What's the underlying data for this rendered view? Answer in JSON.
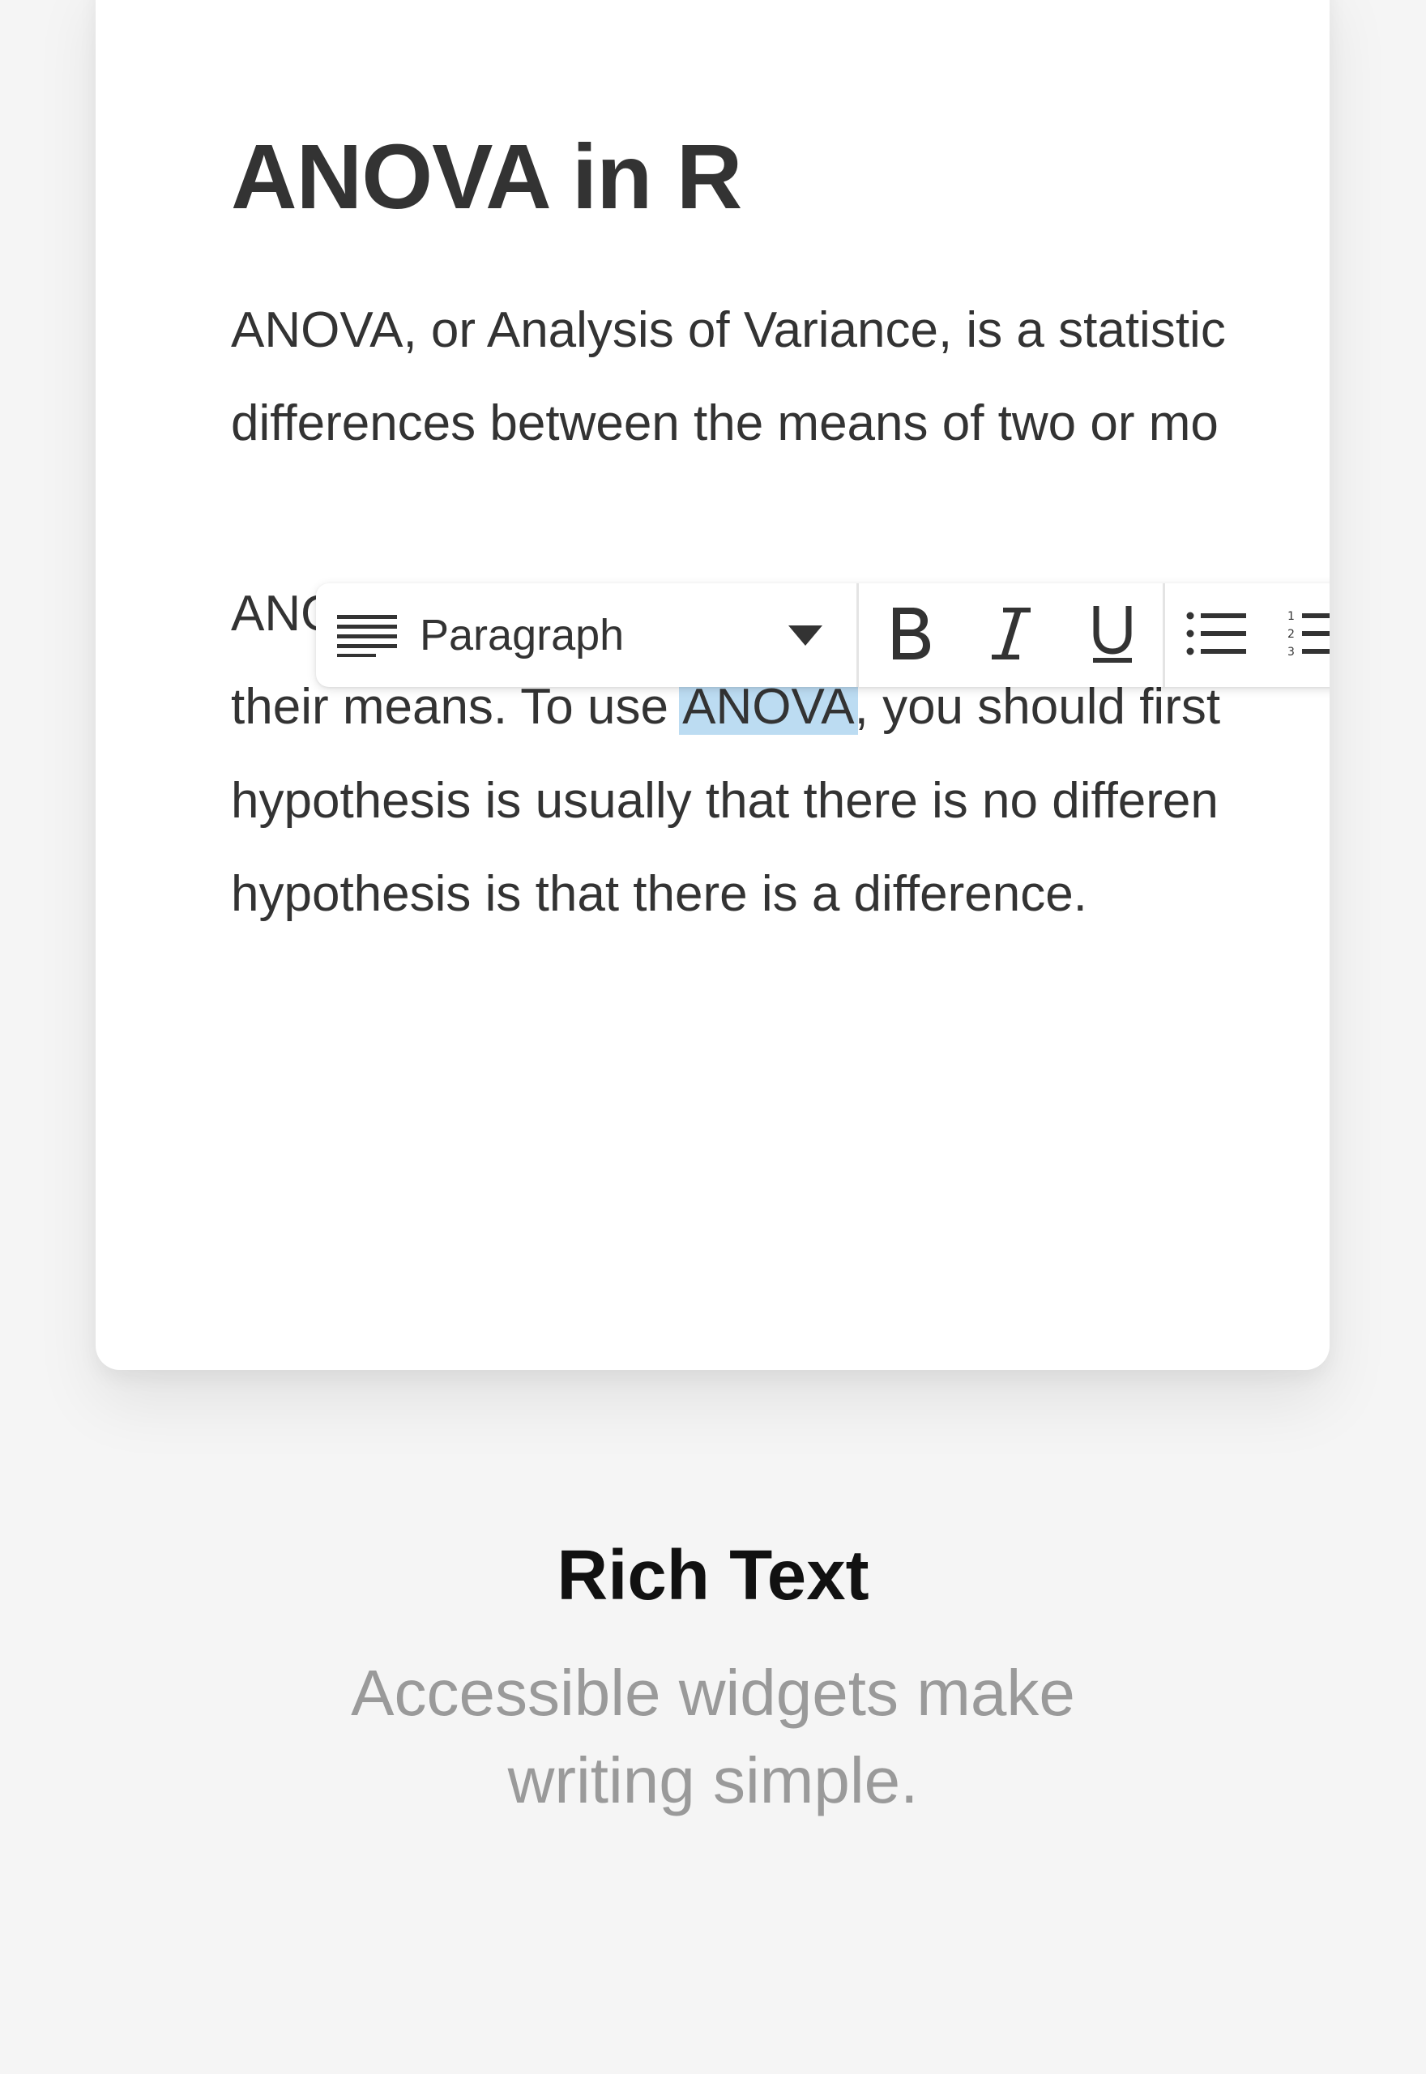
{
  "document": {
    "title": "ANOVA in R",
    "paragraph1": {
      "line1": "ANOVA, or Analysis of Variance, is a statistic",
      "line2": "differences between the means of two or mo"
    },
    "paragraph2": {
      "line1_prefix": "ANO",
      "line2_before": "their means. To use ",
      "line2_selected": "ANOVA",
      "line2_after": ", you should first",
      "line3": "hypothesis is usually that there is no differen",
      "line4": "hypothesis is that there is a difference."
    },
    "selection_color": "#bcdcf2"
  },
  "toolbar": {
    "block_type_icon": "paragraph-lines-icon",
    "block_type_label": "Paragraph",
    "dropdown_icon": "caret-down-icon",
    "buttons": [
      {
        "icon": "bold-icon"
      },
      {
        "icon": "italic-icon"
      },
      {
        "icon": "underline-icon"
      },
      {
        "icon": "bulleted-list-icon"
      },
      {
        "icon": "numbered-list-icon"
      }
    ]
  },
  "feature": {
    "title": "Rich Text",
    "description_line1": "Accessible widgets make",
    "description_line2": "writing simple."
  },
  "colors": {
    "background": "#f5f5f5",
    "card": "#ffffff",
    "text": "#333333",
    "muted": "#9a9a9a"
  }
}
